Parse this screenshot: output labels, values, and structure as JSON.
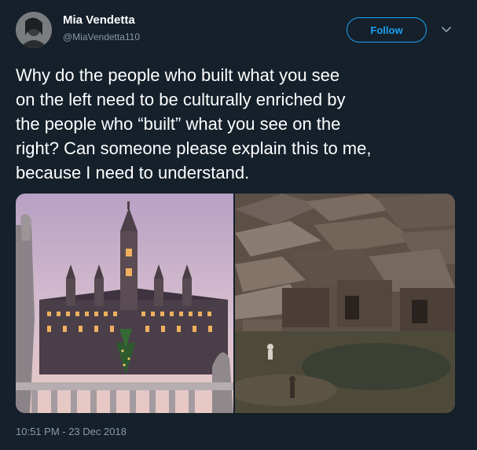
{
  "user": {
    "display_name": "Mia Vendetta",
    "handle": "@MiaVendetta110"
  },
  "follow_label": "Follow",
  "tweet": {
    "text": "Why do the people who built what you see\non the left need to be culturally enriched by\nthe people who “built” what you see on the\nright? Can someone please explain this to me,\nbecause I need to understand."
  },
  "timestamp": "10:51 PM - 23 Dec 2018",
  "icons": {
    "more": "chevron-down-icon"
  },
  "colors": {
    "background": "#15202b",
    "accent": "#1da1f2",
    "secondary_text": "#8899a6"
  }
}
